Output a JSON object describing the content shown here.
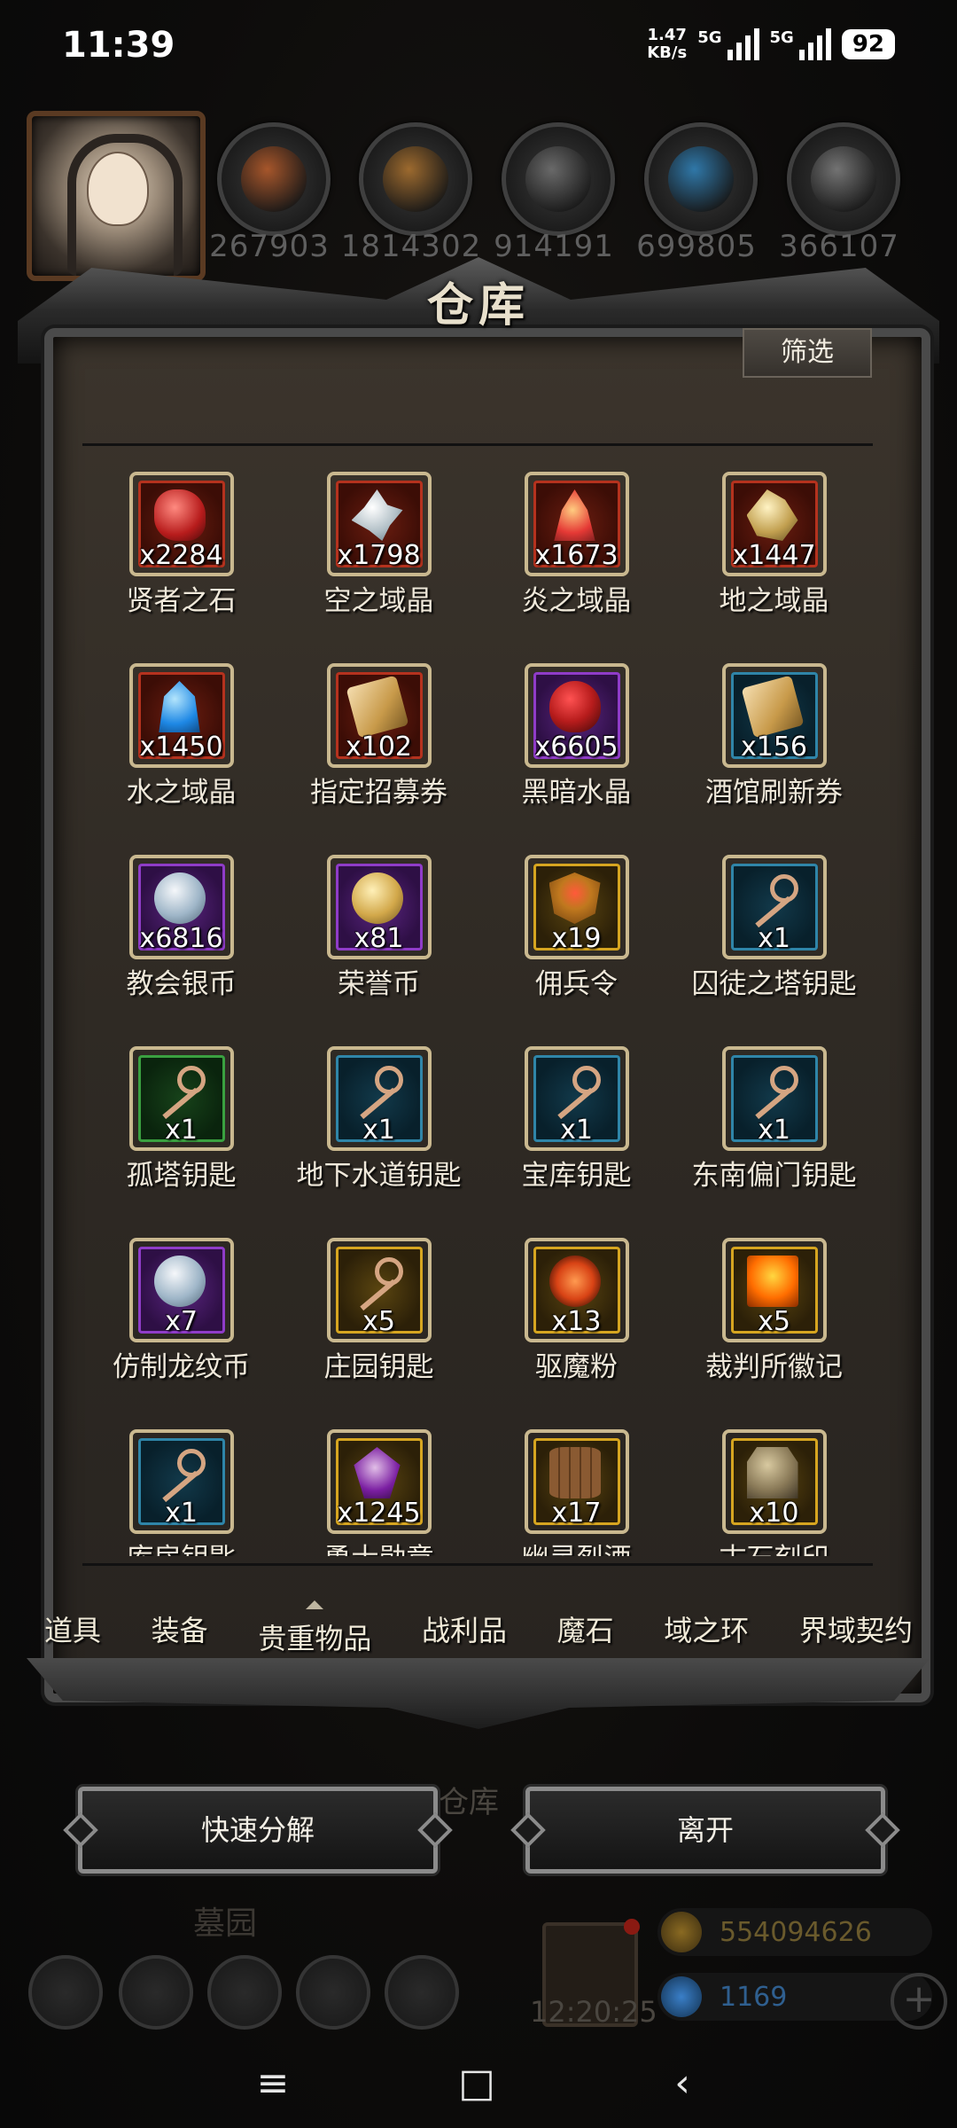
{
  "status_bar": {
    "time": "11:39",
    "speed_value": "1.47",
    "speed_unit": "KB/s",
    "signal1": "5G",
    "signal2": "5G",
    "battery": "92"
  },
  "resources": [
    {
      "value": "267903",
      "color": "#b35a2a",
      "icon": "ore-icon"
    },
    {
      "value": "1814302",
      "color": "#a8702e",
      "icon": "wood-icon"
    },
    {
      "value": "914191",
      "color": "#6f6f6f",
      "icon": "stone-icon"
    },
    {
      "value": "699805",
      "color": "#2f7fb5",
      "icon": "crystal-icon"
    },
    {
      "value": "366107",
      "color": "#7a7a7a",
      "icon": "iron-icon"
    }
  ],
  "panel": {
    "title": "仓库",
    "filter_label": "筛选"
  },
  "items": [
    {
      "name": "贤者之石",
      "qty": "x2284",
      "frame": "red",
      "icon": "crystal-red"
    },
    {
      "name": "空之域晶",
      "qty": "x1798",
      "frame": "red",
      "icon": "crystal-white"
    },
    {
      "name": "炎之域晶",
      "qty": "x1673",
      "frame": "red",
      "icon": "crystal-fire"
    },
    {
      "name": "地之域晶",
      "qty": "x1447",
      "frame": "red",
      "icon": "crystal-earth"
    },
    {
      "name": "水之域晶",
      "qty": "x1450",
      "frame": "red",
      "icon": "crystal-water"
    },
    {
      "name": "指定招募券",
      "qty": "x102",
      "frame": "red",
      "icon": "scroll"
    },
    {
      "name": "黑暗水晶",
      "qty": "x6605",
      "frame": "purple",
      "icon": "dark-crystal"
    },
    {
      "name": "酒馆刷新券",
      "qty": "x156",
      "frame": "blue",
      "icon": "scroll"
    },
    {
      "name": "教会银币",
      "qty": "x6816",
      "frame": "purple",
      "icon": "silver-coin"
    },
    {
      "name": "荣誉币",
      "qty": "x81",
      "frame": "purple",
      "icon": "gold-coin"
    },
    {
      "name": "佣兵令",
      "qty": "x19",
      "frame": "gold",
      "icon": "badge"
    },
    {
      "name": "囚徒之塔钥匙",
      "qty": "x1",
      "frame": "blue",
      "icon": "key"
    },
    {
      "name": "孤塔钥匙",
      "qty": "x1",
      "frame": "green",
      "icon": "key"
    },
    {
      "name": "地下水道钥匙",
      "qty": "x1",
      "frame": "blue",
      "icon": "key"
    },
    {
      "name": "宝库钥匙",
      "qty": "x1",
      "frame": "blue",
      "icon": "key"
    },
    {
      "name": "东南偏门钥匙",
      "qty": "x1",
      "frame": "blue",
      "icon": "key"
    },
    {
      "name": "仿制龙纹币",
      "qty": "x7",
      "frame": "purple",
      "icon": "silver-coin"
    },
    {
      "name": "庄园钥匙",
      "qty": "x5",
      "frame": "gold",
      "icon": "key"
    },
    {
      "name": "驱魔粉",
      "qty": "x13",
      "frame": "gold",
      "icon": "powder"
    },
    {
      "name": "裁判所徽记",
      "qty": "x5",
      "frame": "gold",
      "icon": "card"
    },
    {
      "name": "库房钥匙",
      "qty": "x1",
      "frame": "blue",
      "icon": "key"
    },
    {
      "name": "勇士勋章",
      "qty": "x1245",
      "frame": "gold",
      "icon": "medal"
    },
    {
      "name": "幽灵烈酒",
      "qty": "x17",
      "frame": "gold",
      "icon": "barrel"
    },
    {
      "name": "古石刻印",
      "qty": "x10",
      "frame": "gold",
      "icon": "stone"
    }
  ],
  "tabs": [
    {
      "label": "道具"
    },
    {
      "label": "装备"
    },
    {
      "label": "贵重物品",
      "active": true
    },
    {
      "label": "战利品"
    },
    {
      "label": "魔石"
    },
    {
      "label": "域之环"
    },
    {
      "label": "界域契约"
    }
  ],
  "actions": {
    "decompose": "快速分解",
    "leave": "离开",
    "background_label": "仓库"
  },
  "background": {
    "location": "墓园",
    "timer": "12:20:25",
    "gold": "554094626",
    "gems": "1169",
    "plus": "+"
  },
  "navbar": {
    "menu": "≡",
    "home": "□",
    "back": "‹"
  }
}
